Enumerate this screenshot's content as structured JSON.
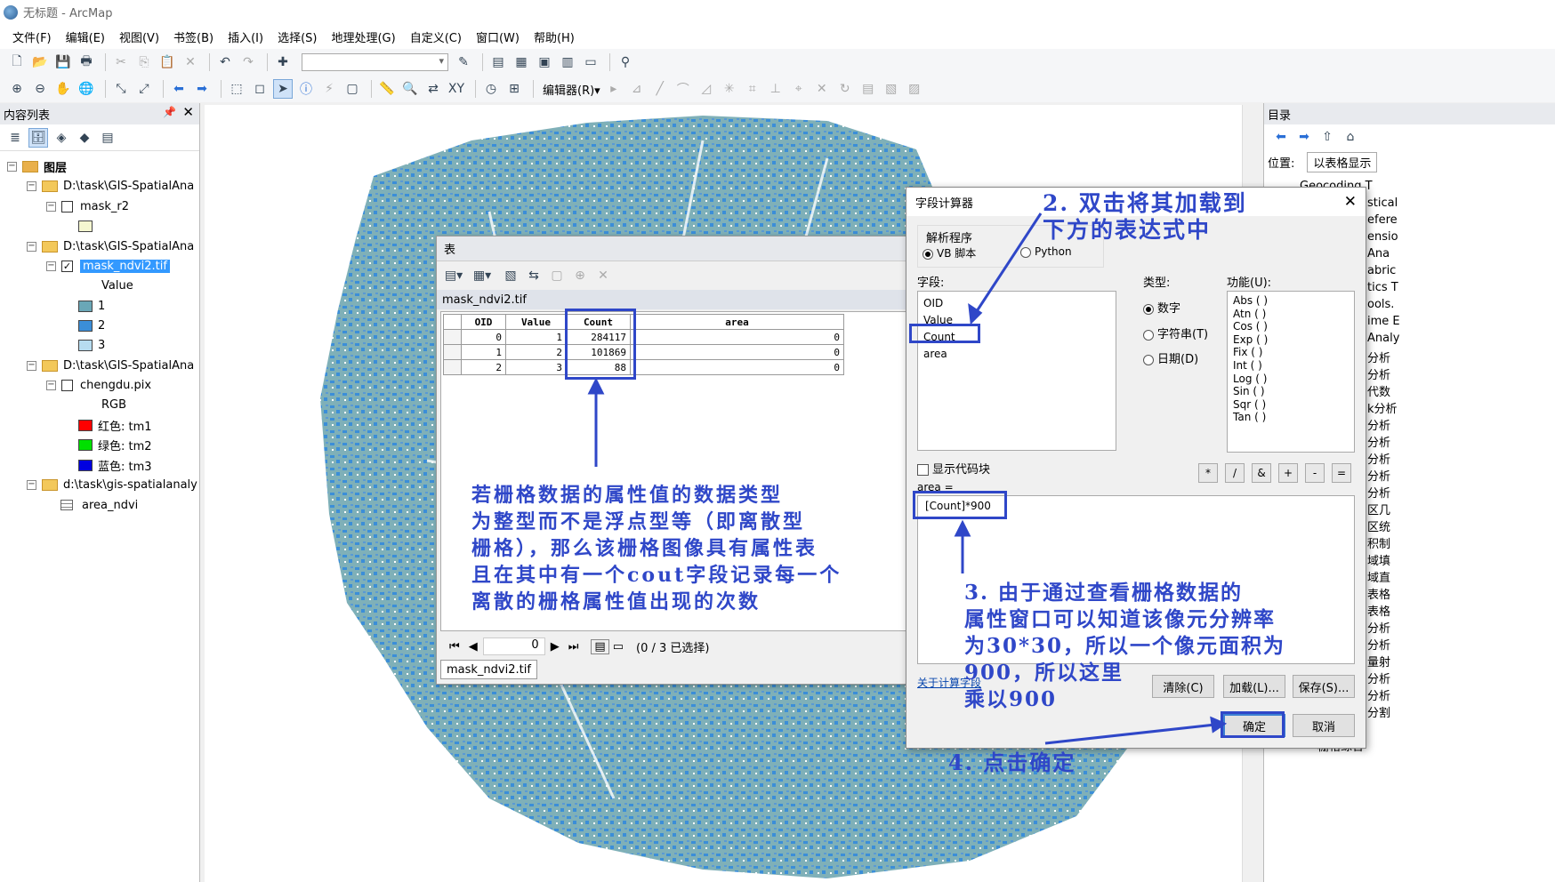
{
  "window": {
    "title": "无标题 - ArcMap"
  },
  "menu": [
    "文件(F)",
    "编辑(E)",
    "视图(V)",
    "书签(B)",
    "插入(I)",
    "选择(S)",
    "地理处理(G)",
    "自定义(C)",
    "窗口(W)",
    "帮助(H)"
  ],
  "toolbar": {
    "editor_label": "编辑器(R)▾"
  },
  "toc": {
    "title": "内容列表",
    "root_label": "图层",
    "items": [
      "D:\\task\\GIS-SpatialAna",
      "mask_r2",
      "D:\\task\\GIS-SpatialAna",
      "mask_ndvi2.tif",
      "Value",
      "1",
      "2",
      "3",
      "D:\\task\\GIS-SpatialAna",
      "chengdu.pix",
      "RGB",
      "红色:   tm1",
      "绿色: tm2",
      "蓝色:   tm3",
      "d:\\task\\gis-spatialanaly",
      "area_ndvi"
    ],
    "class_colors": [
      "#6aa7b7",
      "#3b8ed8",
      "#b7dcf0"
    ],
    "rgb_colors": [
      "#ff0000",
      "#00e000",
      "#0000e0"
    ]
  },
  "catalog": {
    "title": "目录",
    "location_label": "位置:",
    "location_value": "以表格显示",
    "items": [
      "Geocoding T",
      "stical",
      "efere",
      "ensio",
      "Ana",
      "abric",
      "tics T",
      "ools.",
      "ime E",
      "Analy",
      "分析",
      "分析",
      "代数",
      "k分析",
      "分析",
      "分析",
      "分析",
      "分析",
      "分析",
      "区几",
      "区统",
      "积制",
      "域填",
      "域直",
      "表格",
      "表格",
      "分析",
      "分析",
      "量射",
      "分析",
      "分析",
      "分割",
      "栅格创建",
      "栅格综合"
    ]
  },
  "table_window": {
    "title": "表",
    "table_name": "mask_ndvi2.tif",
    "columns": [
      "OID",
      "Value",
      "Count",
      "area"
    ],
    "rows": [
      [
        "0",
        "1",
        "284117",
        "0"
      ],
      [
        "1",
        "2",
        "101869",
        "0"
      ],
      [
        "2",
        "3",
        "88",
        "0"
      ]
    ],
    "nav_value": "0",
    "selection_status": "(0 / 3 已选择)",
    "tab_label": "mask_ndvi2.tif"
  },
  "field_calculator": {
    "title": "字段计算器",
    "parser_label": "解析程序",
    "parser_options": [
      "VB 脚本",
      "Python"
    ],
    "fields_label": "字段:",
    "fields": [
      "OID",
      "Value",
      "Count",
      "area"
    ],
    "type_label": "类型:",
    "types": [
      "数字",
      "字符串(T)",
      "日期(D)"
    ],
    "functions_label": "功能(U):",
    "functions": [
      "Abs ( )",
      "Atn ( )",
      "Cos ( )",
      "Exp ( )",
      "Fix ( )",
      "Int ( )",
      "Log ( )",
      "Sin ( )",
      "Sqr ( )",
      "Tan ( )"
    ],
    "show_codeblock_label": "显示代码块",
    "operators": [
      "*",
      "/",
      "&",
      "+",
      "-",
      "="
    ],
    "expression_label": "area =",
    "expression": "[Count]*900",
    "about_link": "关于计算字段",
    "buttons": {
      "clear": "清除(C)",
      "load": "加载(L)...",
      "save": "保存(S)...",
      "ok": "确定",
      "cancel": "取消"
    }
  },
  "annotations": {
    "step2": [
      "2. 双击将其加载到",
      "下方的表达式中"
    ],
    "step3": [
      "3. 由于通过查看栅格数据的",
      "属性窗口可以知道该像元分辨率",
      "为30*30，所以一个像元面积为",
      "900，所以这里",
      "乘以900"
    ],
    "step4": "4. 点击确定",
    "note": [
      "若栅格数据的属性值的数据类型",
      "为整型而不是浮点型等（即离散型",
      "栅格），那么该栅格图像具有属性表",
      "且在其中有一个cout字段记录每一个",
      "离散的栅格属性值出现的次数"
    ]
  },
  "colors": {
    "annotation": "#2f47c8",
    "map_teal": "#7fb0b8",
    "map_blue": "#3b8ed8"
  }
}
